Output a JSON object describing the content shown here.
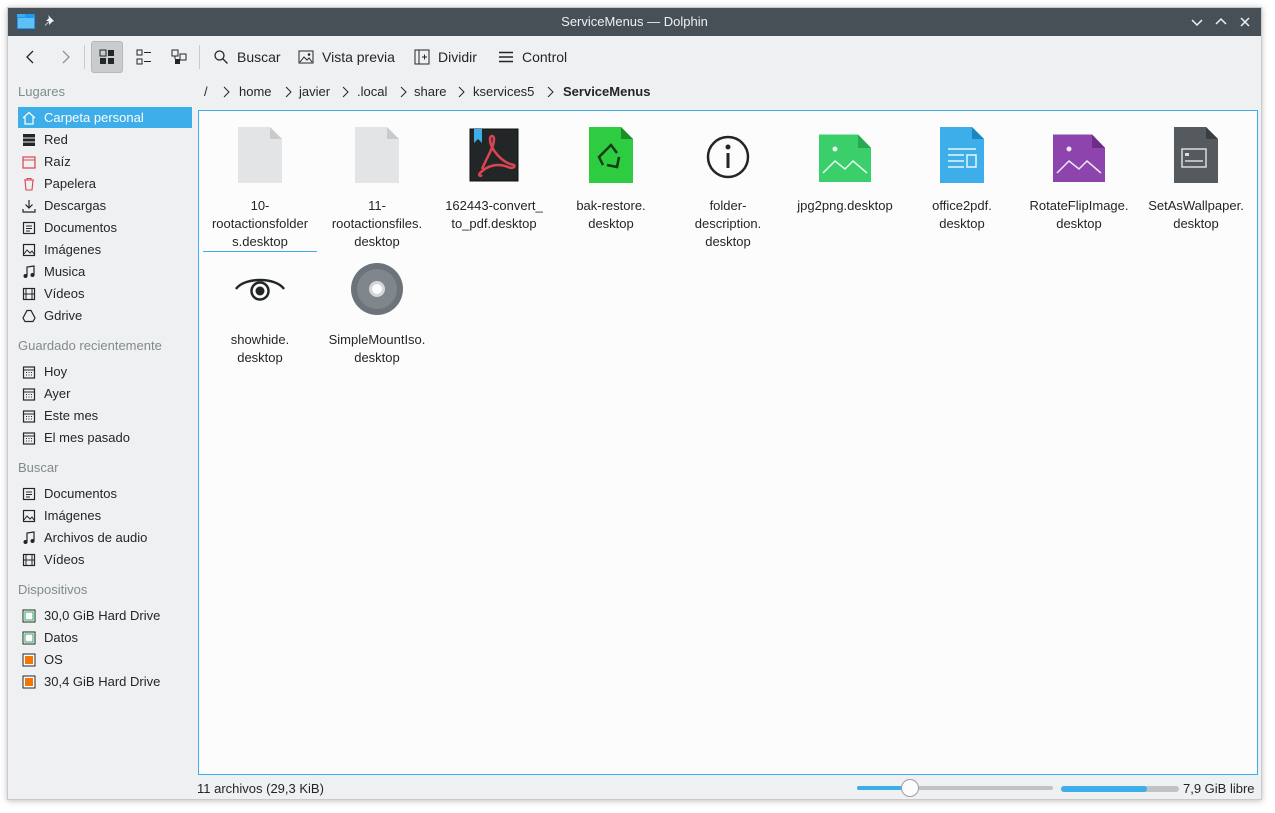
{
  "window": {
    "title": "ServiceMenus — Dolphin",
    "titlebar_color": "#475057",
    "accent_color": "#3daee9"
  },
  "toolbar": {
    "back_icon": "arrow-left-icon",
    "forward_icon": "arrow-right-icon",
    "view_modes": [
      "icons-view",
      "compact-view",
      "details-view"
    ],
    "active_view_mode": "icons-view",
    "search_label": "Buscar",
    "preview_label": "Vista previa",
    "split_label": "Dividir",
    "control_label": "Control"
  },
  "sidebar": {
    "places_title": "Lugares",
    "places": [
      {
        "label": "Carpeta personal",
        "icon": "home-icon",
        "selected": true
      },
      {
        "label": "Red",
        "icon": "network-icon"
      },
      {
        "label": "Raíz",
        "icon": "root-folder-icon"
      },
      {
        "label": "Papelera",
        "icon": "trash-icon"
      },
      {
        "label": "Descargas",
        "icon": "download-icon"
      },
      {
        "label": "Documentos",
        "icon": "document-icon"
      },
      {
        "label": "Imágenes",
        "icon": "image-icon"
      },
      {
        "label": "Musica",
        "icon": "music-icon"
      },
      {
        "label": "Vídeos",
        "icon": "video-icon"
      },
      {
        "label": "Gdrive",
        "icon": "gdrive-icon"
      }
    ],
    "recent_title": "Guardado recientemente",
    "recent": [
      {
        "label": "Hoy",
        "icon": "calendar-icon"
      },
      {
        "label": "Ayer",
        "icon": "calendar-icon"
      },
      {
        "label": "Este mes",
        "icon": "calendar-icon"
      },
      {
        "label": "El mes pasado",
        "icon": "calendar-icon"
      }
    ],
    "search_title": "Buscar",
    "search": [
      {
        "label": "Documentos",
        "icon": "document-icon"
      },
      {
        "label": "Imágenes",
        "icon": "image-icon"
      },
      {
        "label": "Archivos de audio",
        "icon": "music-icon"
      },
      {
        "label": "Vídeos",
        "icon": "video-icon"
      }
    ],
    "devices_title": "Dispositivos",
    "devices": [
      {
        "label": "30,0 GiB Hard Drive",
        "icon": "drive-icon"
      },
      {
        "label": "Datos",
        "icon": "drive-icon"
      },
      {
        "label": "OS",
        "icon": "drive-warning-icon"
      },
      {
        "label": "30,4 GiB Hard Drive",
        "icon": "drive-warning-icon"
      }
    ]
  },
  "breadcrumb": {
    "root": "/",
    "parts": [
      "home",
      "javier",
      ".local",
      "share",
      "kservices5"
    ],
    "current": "ServiceMenus"
  },
  "files": [
    {
      "name": "10-\nrootactionsfolder\ns.desktop",
      "icon": "blank-file-icon"
    },
    {
      "name": "11-\nrootactionsfiles.\ndesktop",
      "icon": "blank-file-icon"
    },
    {
      "name": "162443-convert_\nto_pdf.desktop",
      "icon": "pdf-icon"
    },
    {
      "name": "bak-restore.\ndesktop",
      "icon": "recycle-icon"
    },
    {
      "name": "folder-\ndescription.\ndesktop",
      "icon": "info-icon"
    },
    {
      "name": "jpg2png.desktop",
      "icon": "green-image-icon"
    },
    {
      "name": "office2pdf.\ndesktop",
      "icon": "blue-document-icon"
    },
    {
      "name": "RotateFlipImage.\ndesktop",
      "icon": "purple-image-icon"
    },
    {
      "name": "SetAsWallpaper.\ndesktop",
      "icon": "wallpaper-icon"
    },
    {
      "name": "showhide.\ndesktop",
      "icon": "eye-icon"
    },
    {
      "name": "SimpleMountIso.\ndesktop",
      "icon": "disc-icon"
    }
  ],
  "statusbar": {
    "summary": "11 archivos (29,3 KiB)",
    "zoom_level": 0.27,
    "free_space": "7,9 GiB libre",
    "used_fraction": 0.73
  }
}
